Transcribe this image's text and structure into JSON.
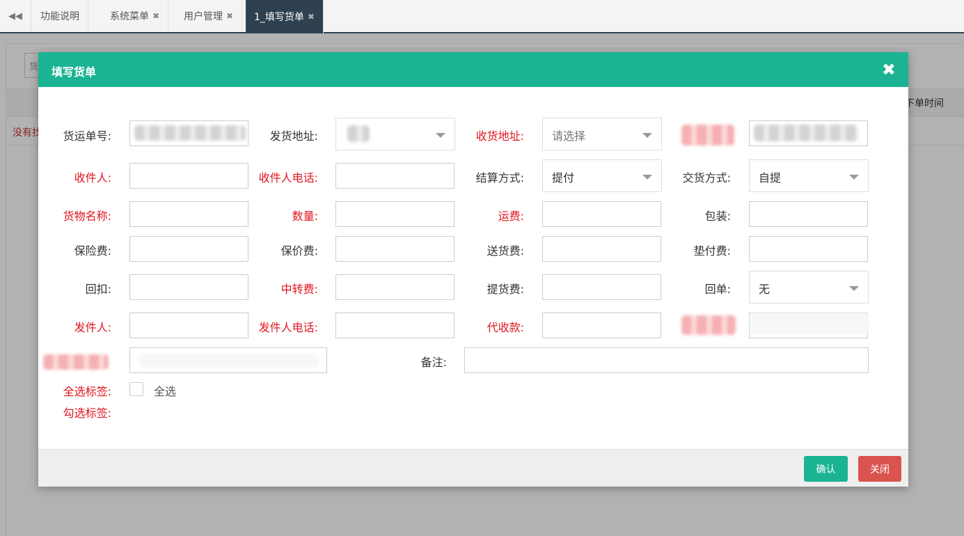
{
  "tabs": {
    "items": [
      "功能说明",
      "系统菜单",
      "用户管理",
      "1_填写货单"
    ],
    "close_glyph": "✖"
  },
  "background": {
    "search_placeholder": "货",
    "column_header": "下单时间",
    "empty_text": "没有找"
  },
  "modal": {
    "title": "填写货单",
    "close_glyph": "✖",
    "confirm_label": "确认",
    "close_label": "关闭"
  },
  "form": {
    "labels": {
      "waybill_no": "货运单号:",
      "ship_address": "发货地址:",
      "receive_address": "收货地址:",
      "receiver": "收件人:",
      "receiver_phone": "收件人电话:",
      "settle_method": "结算方式:",
      "delivery_method": "交货方式:",
      "goods_name": "货物名称:",
      "quantity": "数量:",
      "freight": "运费:",
      "packaging": "包装:",
      "insurance_fee": "保险费:",
      "valuation_fee": "保价费:",
      "delivery_fee": "送货费:",
      "advance_fee": "垫付费:",
      "rebate": "回扣:",
      "transfer_fee": "中转费:",
      "pickup_fee": "提货费:",
      "return_receipt": "回单:",
      "sender": "发件人:",
      "sender_phone": "发件人电话:",
      "cod": "代收款:",
      "remark": "备注:",
      "select_all_tags": "全选标签:",
      "checked_tags": "勾选标签:"
    },
    "selects": {
      "receive_address_placeholder": "请选择",
      "settle_method_value": "提付",
      "delivery_method_value": "自提",
      "return_receipt_value": "无"
    },
    "select_all_checkbox_label": "全选"
  },
  "colors": {
    "accent": "#1ab394",
    "danger": "#d9534f",
    "required_label": "#e0151f",
    "tab_active": "#2f4050"
  }
}
